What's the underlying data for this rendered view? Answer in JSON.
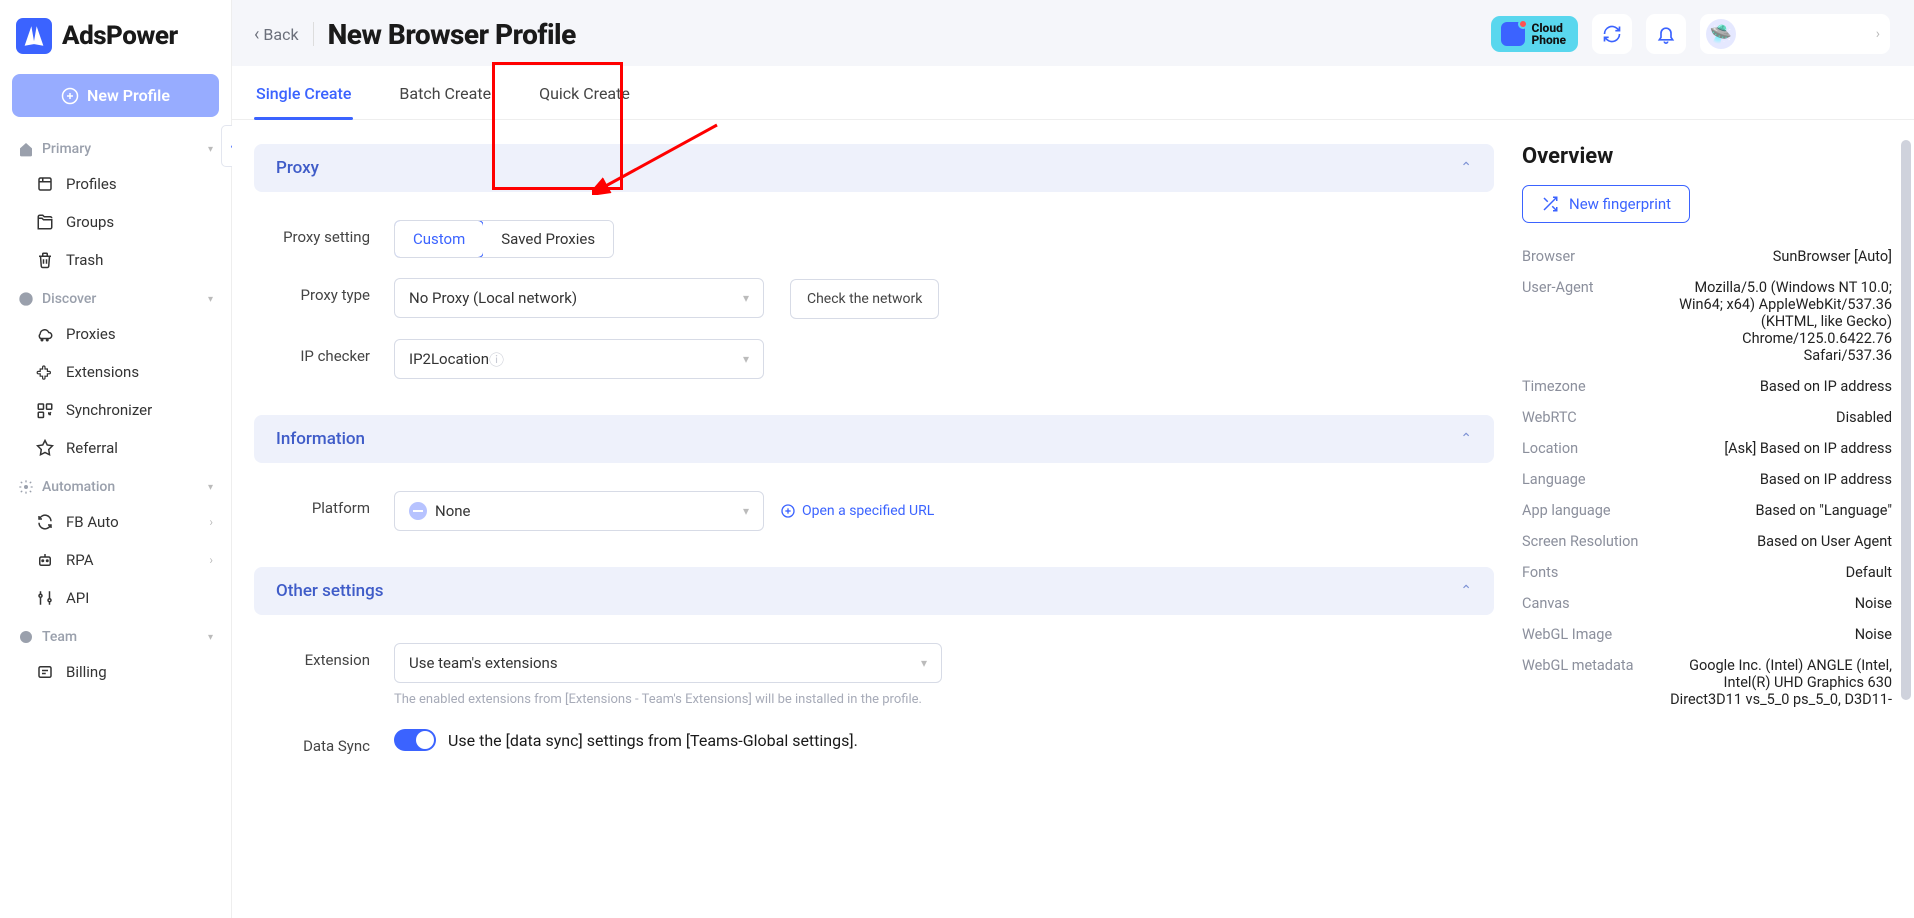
{
  "brand": "AdsPower",
  "sidebar": {
    "new_profile": "New Profile",
    "sections": {
      "primary": {
        "label": "Primary",
        "items": [
          "Profiles",
          "Groups",
          "Trash"
        ]
      },
      "discover": {
        "label": "Discover",
        "items": [
          "Proxies",
          "Extensions",
          "Synchronizer",
          "Referral"
        ]
      },
      "automation": {
        "label": "Automation",
        "items": [
          "FB Auto",
          "RPA",
          "API"
        ]
      },
      "team": {
        "label": "Team",
        "items": [
          "Billing"
        ]
      }
    }
  },
  "header": {
    "back": "Back",
    "title": "New Browser Profile",
    "cloud_phone_top": "Cloud",
    "cloud_phone_bottom": "Phone"
  },
  "tabs": [
    "Single Create",
    "Batch Create",
    "Quick Create"
  ],
  "panels": {
    "proxy": {
      "title": "Proxy",
      "proxy_setting_label": "Proxy setting",
      "seg_custom": "Custom",
      "seg_saved": "Saved Proxies",
      "proxy_type_label": "Proxy type",
      "proxy_type_value": "No Proxy (Local network)",
      "check_network": "Check the network",
      "ip_checker_label": "IP checker",
      "ip_checker_value": "IP2Location"
    },
    "information": {
      "title": "Information",
      "platform_label": "Platform",
      "platform_value": "None",
      "open_url": "Open a specified URL"
    },
    "other": {
      "title": "Other settings",
      "extension_label": "Extension",
      "extension_value": "Use team's extensions",
      "extension_help": "The enabled extensions from [Extensions - Team's Extensions] will be installed in the profile.",
      "data_sync_label": "Data Sync",
      "data_sync_text": "Use the [data sync] settings from [Teams-Global settings]."
    }
  },
  "overview": {
    "title": "Overview",
    "new_fingerprint": "New fingerprint",
    "rows": [
      {
        "k": "Browser",
        "v": "SunBrowser [Auto]"
      },
      {
        "k": "User-Agent",
        "v": "Mozilla/5.0 (Windows NT 10.0; Win64; x64) AppleWebKit/537.36 (KHTML, like Gecko) Chrome/125.0.6422.76 Safari/537.36"
      },
      {
        "k": "Timezone",
        "v": "Based on IP address"
      },
      {
        "k": "WebRTC",
        "v": "Disabled"
      },
      {
        "k": "Location",
        "v": "[Ask] Based on IP address"
      },
      {
        "k": "Language",
        "v": "Based on IP address"
      },
      {
        "k": "App language",
        "v": "Based on \"Language\""
      },
      {
        "k": "Screen Resolution",
        "v": "Based on User Agent"
      },
      {
        "k": "Fonts",
        "v": "Default"
      },
      {
        "k": "Canvas",
        "v": "Noise"
      },
      {
        "k": "WebGL Image",
        "v": "Noise"
      },
      {
        "k": "WebGL metadata",
        "v": "Google Inc. (Intel) ANGLE (Intel, Intel(R) UHD Graphics 630 Direct3D11 vs_5_0 ps_5_0, D3D11-"
      }
    ]
  }
}
